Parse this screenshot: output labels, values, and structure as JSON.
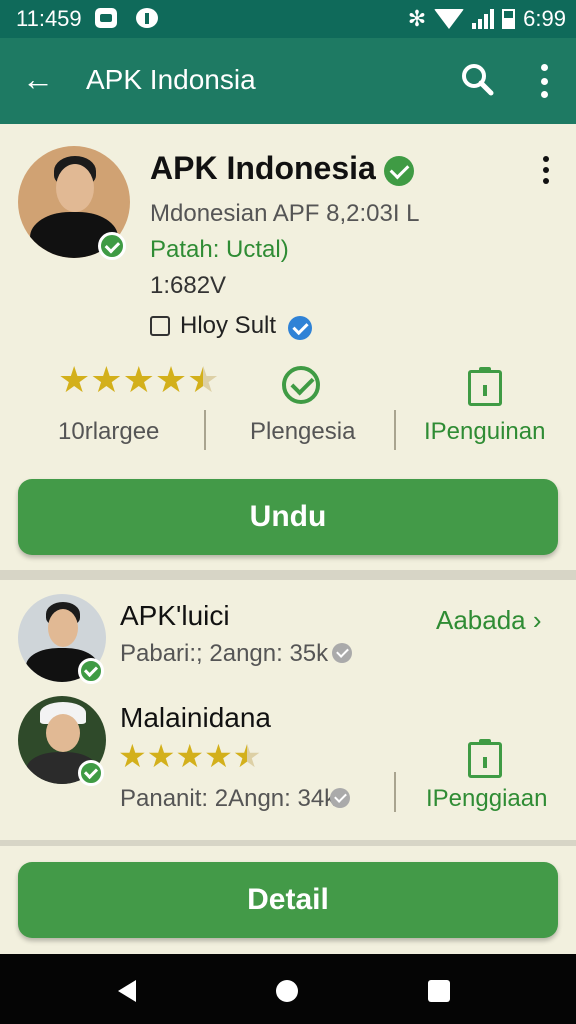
{
  "status_bar": {
    "time": "11:459",
    "right_time": "6:99"
  },
  "app_bar": {
    "title": "APK Indonsia"
  },
  "profile": {
    "name": "APK Indonesia",
    "line1": "Mdonesian APF 8,2:03I L",
    "line2": "Patah: Uctal)",
    "line3": "1:682V",
    "checkbox_label": "Hloy Sult"
  },
  "stats": [
    {
      "label": "10rlargee",
      "rating": 4.5
    },
    {
      "label": "Plengesia"
    },
    {
      "label": "IPenguinan"
    }
  ],
  "primary_button": "Undu",
  "list": {
    "action": "Aabada",
    "items": [
      {
        "title": "APK'luici",
        "subtitle": "Pabari:; 2angn: 35k"
      },
      {
        "title": "Malainidana",
        "rating": 4.5,
        "subtitle": "Pananit: 2Angn: 34k",
        "tag": "IPenggiaan"
      }
    ]
  },
  "detail_button": "Detail",
  "colors": {
    "brand": "#1e7a63",
    "accent": "#439a48",
    "background": "#f1efdd"
  }
}
